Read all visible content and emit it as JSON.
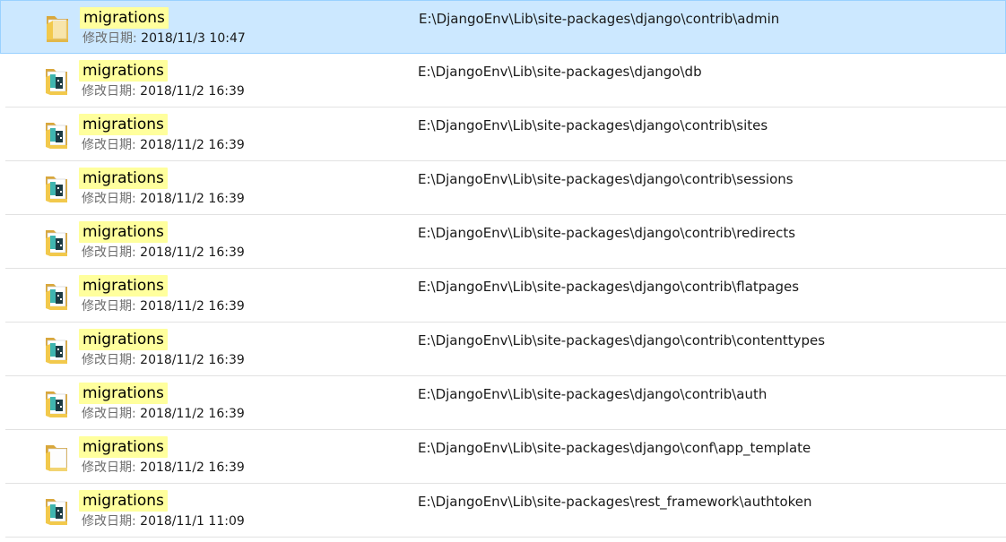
{
  "results": [
    {
      "name": "migrations",
      "date_label": "修改日期:",
      "date": "2018/11/3 10:47",
      "path": "E:\\DjangoEnv\\Lib\\site-packages\\django\\contrib\\admin",
      "icon": "folder-open-icon",
      "selected": true
    },
    {
      "name": "migrations",
      "date_label": "修改日期:",
      "date": "2018/11/2 16:39",
      "path": "E:\\DjangoEnv\\Lib\\site-packages\\django\\db",
      "icon": "folder-python-icon",
      "selected": false
    },
    {
      "name": "migrations",
      "date_label": "修改日期:",
      "date": "2018/11/2 16:39",
      "path": "E:\\DjangoEnv\\Lib\\site-packages\\django\\contrib\\sites",
      "icon": "folder-python-icon",
      "selected": false
    },
    {
      "name": "migrations",
      "date_label": "修改日期:",
      "date": "2018/11/2 16:39",
      "path": "E:\\DjangoEnv\\Lib\\site-packages\\django\\contrib\\sessions",
      "icon": "folder-python-icon",
      "selected": false
    },
    {
      "name": "migrations",
      "date_label": "修改日期:",
      "date": "2018/11/2 16:39",
      "path": "E:\\DjangoEnv\\Lib\\site-packages\\django\\contrib\\redirects",
      "icon": "folder-python-icon",
      "selected": false
    },
    {
      "name": "migrations",
      "date_label": "修改日期:",
      "date": "2018/11/2 16:39",
      "path": "E:\\DjangoEnv\\Lib\\site-packages\\django\\contrib\\flatpages",
      "icon": "folder-python-icon",
      "selected": false
    },
    {
      "name": "migrations",
      "date_label": "修改日期:",
      "date": "2018/11/2 16:39",
      "path": "E:\\DjangoEnv\\Lib\\site-packages\\django\\contrib\\contenttypes",
      "icon": "folder-python-icon",
      "selected": false
    },
    {
      "name": "migrations",
      "date_label": "修改日期:",
      "date": "2018/11/2 16:39",
      "path": "E:\\DjangoEnv\\Lib\\site-packages\\django\\contrib\\auth",
      "icon": "folder-python-icon",
      "selected": false
    },
    {
      "name": "migrations",
      "date_label": "修改日期:",
      "date": "2018/11/2 16:39",
      "path": "E:\\DjangoEnv\\Lib\\site-packages\\django\\conf\\app_template",
      "icon": "folder-document-icon",
      "selected": false
    },
    {
      "name": "migrations",
      "date_label": "修改日期:",
      "date": "2018/11/1 11:09",
      "path": "E:\\DjangoEnv\\Lib\\site-packages\\rest_framework\\authtoken",
      "icon": "folder-python-icon",
      "selected": false
    }
  ],
  "colors": {
    "selection_bg": "#cce8ff",
    "selection_border": "#99d1ff",
    "highlight": "#ffff9d",
    "folder_yellow": "#f2c94c",
    "python_teal": "#3fb5b0"
  }
}
